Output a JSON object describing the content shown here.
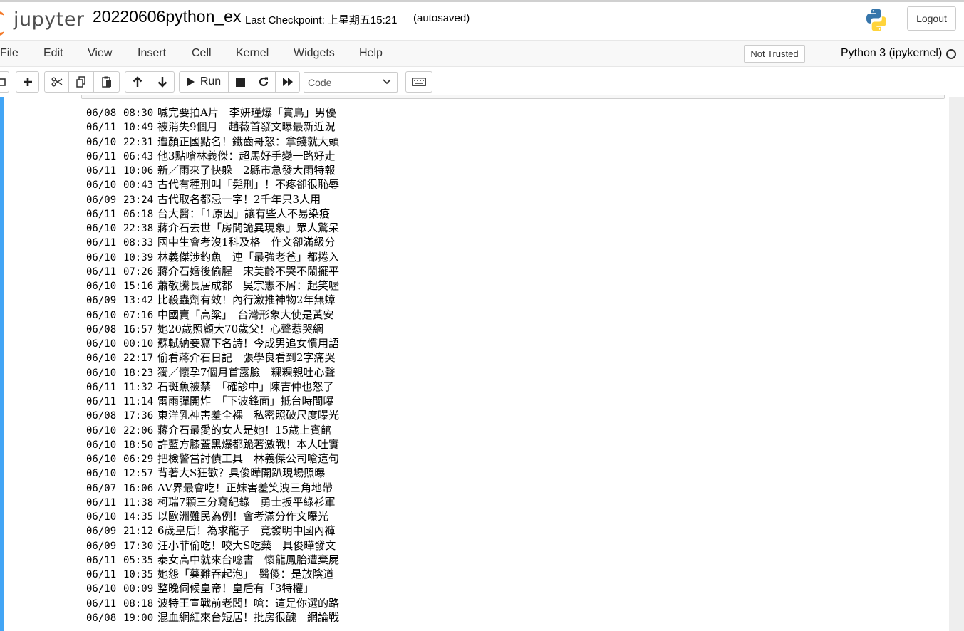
{
  "header": {
    "logo_text": "jupyter",
    "notebook_name": "20220606python_ex",
    "checkpoint": "Last Checkpoint: 上星期五15:21",
    "autosave": "(autosaved)",
    "logout_label": "Logout"
  },
  "menubar": {
    "items": [
      "File",
      "Edit",
      "View",
      "Insert",
      "Cell",
      "Kernel",
      "Widgets",
      "Help"
    ],
    "trust_label": "Not Trusted",
    "kernel_name": "Python 3 (ipykernel)"
  },
  "toolbar": {
    "run_label": "Run",
    "cell_type": "Code"
  },
  "output_lines": [
    {
      "date": "06/08",
      "time": "08:30",
      "title": "喊完要拍A片　李妍瑾爆「賞鳥」男優"
    },
    {
      "date": "06/11",
      "time": "10:49",
      "title": "被消失9個月　趙薇首發文曝最新近況"
    },
    {
      "date": "06/10",
      "time": "22:31",
      "title": "遭顏正國點名！鐵齒哥怒：拿錢就大頭"
    },
    {
      "date": "06/11",
      "time": "06:43",
      "title": "他3點嗆林義傑：超馬好手變一路好走"
    },
    {
      "date": "06/11",
      "time": "10:06",
      "title": "新／雨來了快躲　2縣市急發大雨特報"
    },
    {
      "date": "06/10",
      "time": "00:43",
      "title": "古代有種刑叫「髡刑」！不疼卻很恥辱"
    },
    {
      "date": "06/09",
      "time": "23:24",
      "title": "古代取名都忌一字！2千年只3人用"
    },
    {
      "date": "06/11",
      "time": "06:18",
      "title": "台大醫：「1原因」讓有些人不易染疫"
    },
    {
      "date": "06/10",
      "time": "22:38",
      "title": "蔣介石去世「房間詭異現象」眾人驚呆"
    },
    {
      "date": "06/11",
      "time": "08:33",
      "title": "國中生會考沒1科及格　作文卻滿級分"
    },
    {
      "date": "06/10",
      "time": "10:39",
      "title": "林義傑涉釣魚　連「最強老爸」都捲入"
    },
    {
      "date": "06/11",
      "time": "07:26",
      "title": "蔣介石婚後偷腥　宋美齡不哭不鬧擺平"
    },
    {
      "date": "06/10",
      "time": "15:16",
      "title": "蕭敬騰長居成都　吳宗憲不屑：起笑喔"
    },
    {
      "date": "06/09",
      "time": "13:42",
      "title": "比殺蟲劑有效！內行激推神物2年無蟑"
    },
    {
      "date": "06/10",
      "time": "07:16",
      "title": "中國賣「高粱」　台灣形象大使是黃安"
    },
    {
      "date": "06/08",
      "time": "16:57",
      "title": "她20歲照顧大70歲父！心聲惹哭網"
    },
    {
      "date": "06/10",
      "time": "00:10",
      "title": "蘇軾納妾寫下名詩！今成男追女慣用語"
    },
    {
      "date": "06/10",
      "time": "22:17",
      "title": "偷看蔣介石日記　張學良看到2字痛哭"
    },
    {
      "date": "06/10",
      "time": "18:23",
      "title": "獨／懷孕7個月首露臉　粿粿親吐心聲"
    },
    {
      "date": "06/11",
      "time": "11:32",
      "title": "石斑魚被禁　「確診中」陳吉仲也怒了"
    },
    {
      "date": "06/11",
      "time": "11:14",
      "title": "雷雨彈開炸　「下波鋒面」抵台時間曝"
    },
    {
      "date": "06/08",
      "time": "17:36",
      "title": "東洋乳神害羞全裸　私密照破尺度曝光"
    },
    {
      "date": "06/10",
      "time": "22:06",
      "title": "蔣介石最愛的女人是她！15歲上賓館"
    },
    {
      "date": "06/10",
      "time": "18:50",
      "title": "許藍方膝蓋黑爆都跪著激戰！本人吐實"
    },
    {
      "date": "06/10",
      "time": "06:29",
      "title": "把檢警當討債工具　林義傑公司嗆這句"
    },
    {
      "date": "06/10",
      "time": "12:57",
      "title": "背著大S狂歡？具俊曄開趴現場照曝"
    },
    {
      "date": "06/07",
      "time": "16:06",
      "title": "AV界最會吃！正妹害羞笑洩三角地帶"
    },
    {
      "date": "06/11",
      "time": "11:38",
      "title": "柯瑞7顆三分寫紀錄　勇士扳平綠衫軍"
    },
    {
      "date": "06/10",
      "time": "14:35",
      "title": "以歐洲難民為例！會考滿分作文曝光"
    },
    {
      "date": "06/09",
      "time": "21:12",
      "title": "6歲皇后！為求龍子　竟發明中國內褲"
    },
    {
      "date": "06/09",
      "time": "17:30",
      "title": "汪小菲偷吃！咬大S吃藥　具俊曄發文"
    },
    {
      "date": "06/11",
      "time": "05:35",
      "title": "泰女高中就來台唸書　懷龍鳳胎遭棄屍"
    },
    {
      "date": "06/11",
      "time": "10:35",
      "title": "她怨「藥難吞起泡」　醫傻：是放陰道"
    },
    {
      "date": "06/10",
      "time": "00:09",
      "title": "整晚伺候皇帝！皇后有「3特權」"
    },
    {
      "date": "06/11",
      "time": "08:18",
      "title": "波特王宣戰前老闆！嗆：這是你選的路"
    },
    {
      "date": "06/08",
      "time": "19:00",
      "title": "混血網紅來台短居！批房很醜　網論戰"
    }
  ]
}
